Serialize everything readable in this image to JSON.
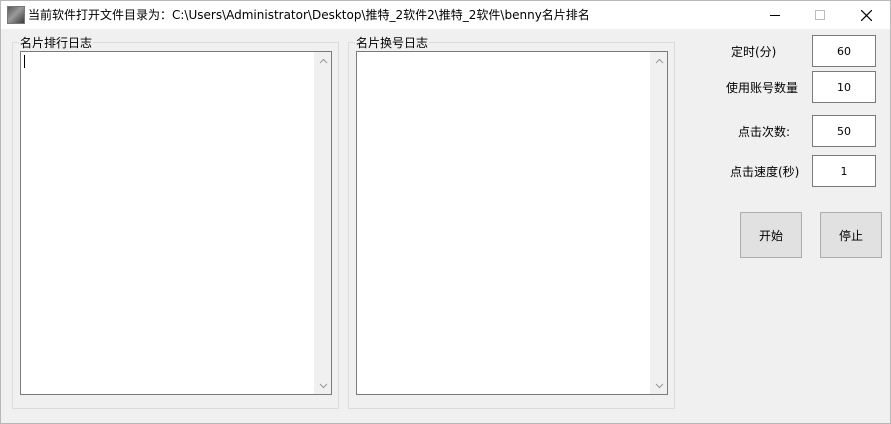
{
  "window": {
    "title": "当前软件打开文件目录为：C:\\Users\\Administrator\\Desktop\\推特_2软件2\\推特_2软件\\benny名片排名",
    "icon": "app-icon",
    "controls": [
      "minimize-icon",
      "maximize-icon",
      "close-icon"
    ]
  },
  "logs": {
    "ranking_log": {
      "label": "名片排行日志",
      "content": ""
    },
    "switch_log": {
      "label": "名片换号日志",
      "content": ""
    }
  },
  "settings": {
    "timer": {
      "label": "定时(分)",
      "value": "60"
    },
    "accounts": {
      "label": "使用账号数量",
      "value": "10"
    },
    "clicks": {
      "label": "点击次数:",
      "value": "50"
    },
    "speed": {
      "label": "点击速度(秒)",
      "value": "1"
    }
  },
  "actions": {
    "start_label": "开始",
    "stop_label": "停止"
  }
}
